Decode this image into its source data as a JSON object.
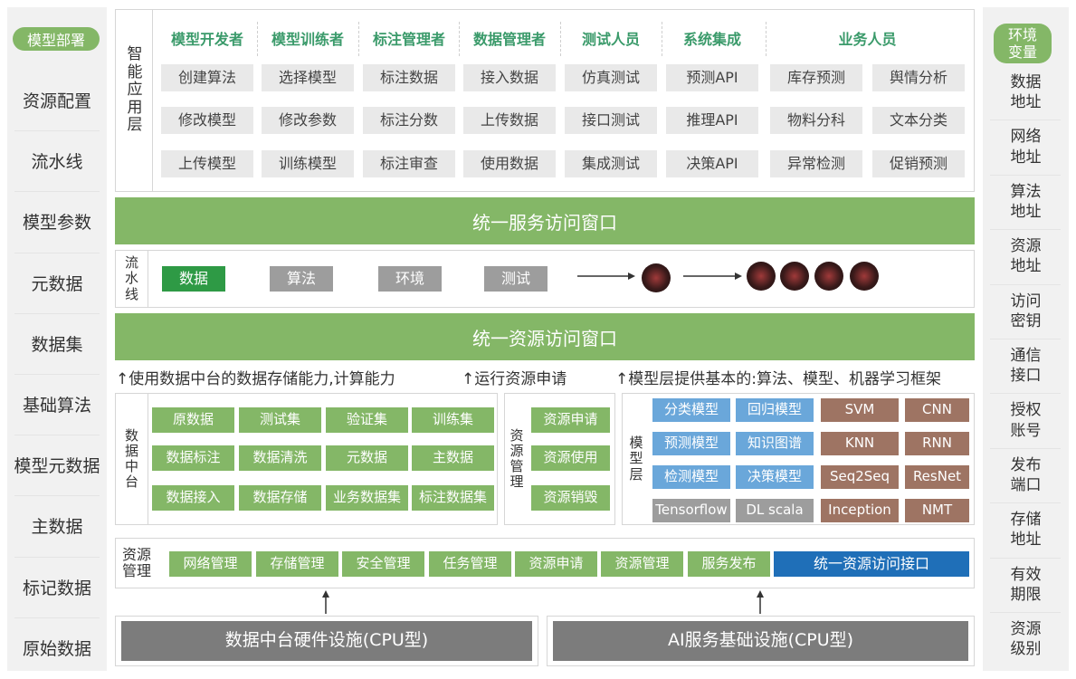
{
  "left_sidebar": {
    "header": "模型部署",
    "items": [
      "资源配置",
      "流水线",
      "模型参数",
      "元数据",
      "数据集",
      "基础算法",
      "模型元数据",
      "主数据",
      "标记数据",
      "原始数据"
    ]
  },
  "right_sidebar": {
    "header": "环境\n变量",
    "items": [
      "数据\n地址",
      "网络\n地址",
      "算法\n地址",
      "资源\n地址",
      "访问\n密钥",
      "通信\n接口",
      "授权\n账号",
      "发布\n端口",
      "存储\n地址",
      "有效\n期限",
      "资源\n级别"
    ]
  },
  "app_layer": {
    "title": "智\n能\n应\n用\n层",
    "roles": [
      "模型开发者",
      "模型训练者",
      "标注管理者",
      "数据管理者",
      "测试人员",
      "系统集成",
      "业务人员"
    ],
    "columns": [
      [
        "创建算法",
        "修改模型",
        "上传模型"
      ],
      [
        "选择模型",
        "修改参数",
        "训练模型"
      ],
      [
        "标注数据",
        "标注分数",
        "标注审查"
      ],
      [
        "接入数据",
        "上传数据",
        "使用数据"
      ],
      [
        "仿真测试",
        "接口测试",
        "集成测试"
      ],
      [
        "预测API",
        "推理API",
        "决策API"
      ],
      [
        "库存预测",
        "物料分科",
        "异常检测"
      ],
      [
        "舆情分析",
        "文本分类",
        "促销预测"
      ]
    ]
  },
  "service_window": "统一服务访问窗口",
  "pipeline": {
    "title": "流\n水\n线",
    "stages": [
      "数据",
      "算法",
      "环境",
      "测试"
    ]
  },
  "resource_window": "统一资源访问窗口",
  "notes": [
    "↑使用数据中台的数据存储能力,计算能力",
    "↑运行资源申请",
    "↑模型层提供基本的:算法、模型、机器学习框架"
  ],
  "data_platform": {
    "title": "数\n据\n中\n台",
    "rows": [
      [
        "原数据",
        "测试集",
        "验证集",
        "训练集"
      ],
      [
        "数据标注",
        "数据清洗",
        "元数据",
        "主数据"
      ],
      [
        "数据接入",
        "数据存储",
        "业务数据集",
        "标注数据集"
      ]
    ]
  },
  "resource_mgmt_small": {
    "title": "资\n源\n管\n理",
    "items": [
      "资源申请",
      "资源使用",
      "资源销毁"
    ]
  },
  "model_layer": {
    "title": "模\n型\n层",
    "blue": [
      [
        "分类模型",
        "回归模型"
      ],
      [
        "预测模型",
        "知识图谱"
      ],
      [
        "检测模型",
        "决策模型"
      ]
    ],
    "brown": [
      [
        "SVM",
        "CNN"
      ],
      [
        "KNN",
        "RNN"
      ],
      [
        "Seq2Seq",
        "ResNet"
      ],
      [
        "Inception",
        "NMT"
      ]
    ],
    "grey": [
      "Tensorflow",
      "DL scala"
    ]
  },
  "resource_bar": {
    "title": "资源\n管理",
    "items": [
      "网络管理",
      "存储管理",
      "安全管理",
      "任务管理",
      "资源申请",
      "资源管理",
      "服务发布"
    ],
    "highlight": "统一资源访问接口"
  },
  "infrastructure": [
    "数据中台硬件设施(CPU型)",
    "AI服务基础设施(CPU型)"
  ],
  "colors": {
    "green": "#84b767",
    "dark_green": "#2e9a45",
    "grey": "#9d9d9d",
    "blue": "#6aa7da",
    "brown": "#9e7463",
    "navy": "#1f6fb8",
    "role_text": "#3a9a6a"
  }
}
